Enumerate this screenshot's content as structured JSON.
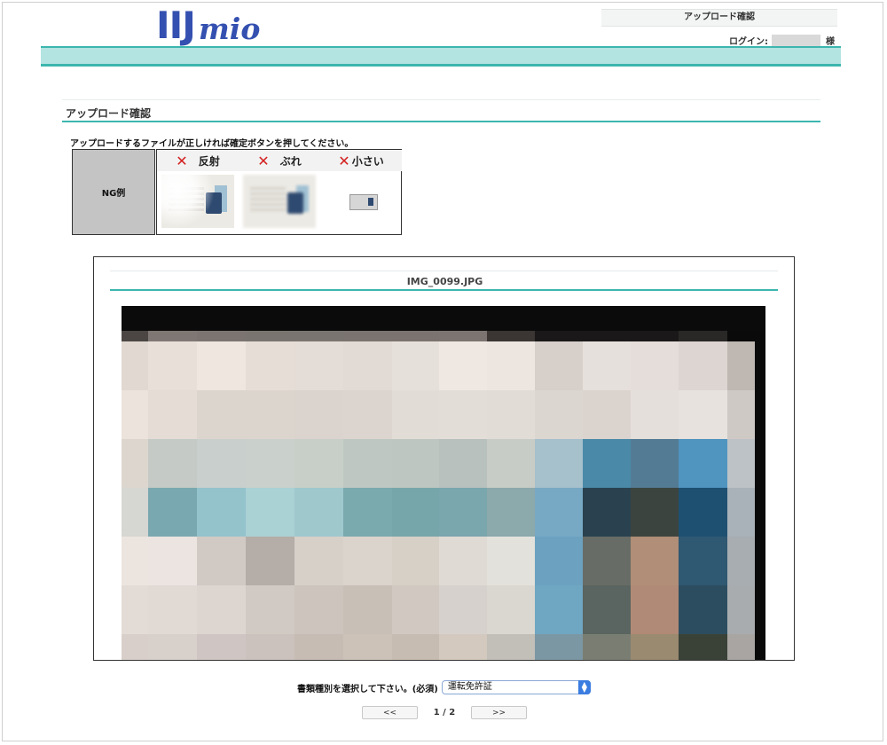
{
  "header": {
    "logo_main": "IIJ",
    "logo_sub": "mio",
    "page_title": "アップロード確認",
    "login_label": "ログイン:",
    "honorific": "様"
  },
  "section": {
    "title": "アップロード確認",
    "instruction": "アップロードするファイルが正しければ確定ボタンを押してください。"
  },
  "ng_examples": {
    "label": "NG例",
    "items": [
      {
        "mark": "✕",
        "label": "反射"
      },
      {
        "mark": "✕",
        "label": "ぶれ"
      },
      {
        "mark": "✕",
        "label": "小さい"
      }
    ]
  },
  "preview": {
    "filename": "IMG_0099.JPG"
  },
  "document_type": {
    "label": "書類種別を選択して下さい。(必須)",
    "selected": "運転免許証"
  },
  "pager": {
    "prev": "<<",
    "info": "1 / 2",
    "next": ">>"
  },
  "colors": {
    "brand": "#3450b0",
    "teal_line": "#3cb6ae",
    "teal_band": "#b3e4e2",
    "ng_mark": "#d42020"
  }
}
